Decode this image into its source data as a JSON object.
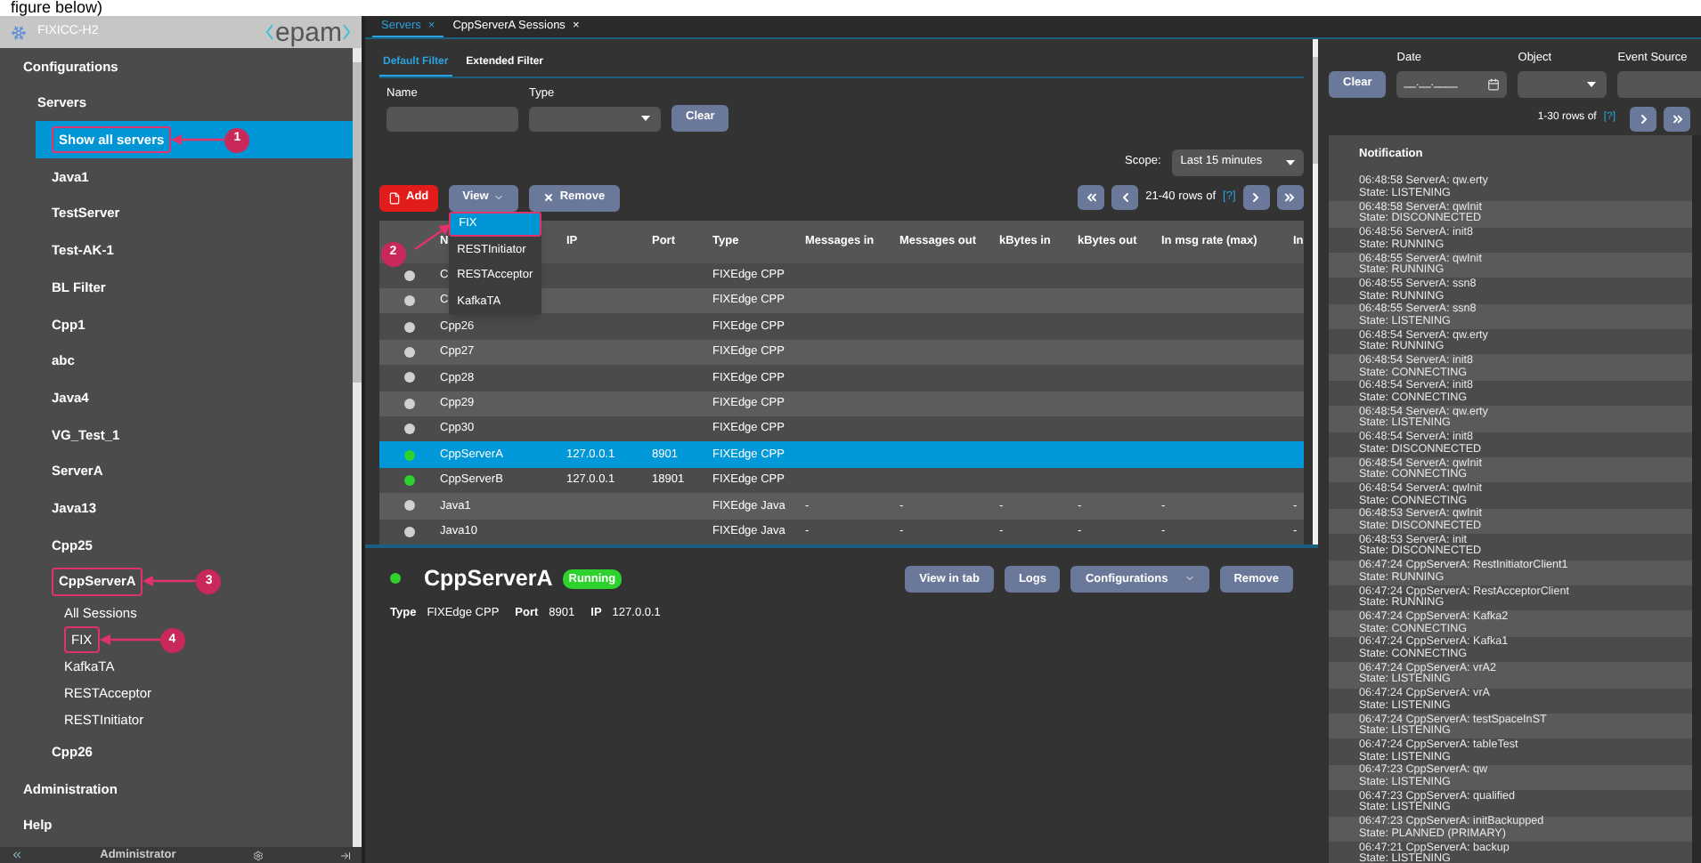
{
  "page_caption": "figure below)",
  "app": {
    "title": "FIXICC-H2",
    "logo": "epam"
  },
  "sidebar": {
    "items": [
      {
        "label": "Configurations",
        "selected": false,
        "children": [
          {
            "label": "Servers",
            "selected": false,
            "children": [
              {
                "label": "Show all servers",
                "selected": true,
                "callout": "1"
              },
              {
                "label": "Java1",
                "selected": false
              },
              {
                "label": "TestServer",
                "selected": false
              },
              {
                "label": "Test-AK-1",
                "selected": false
              },
              {
                "label": "BL Filter",
                "selected": false
              },
              {
                "label": "Cpp1",
                "selected": false
              },
              {
                "label": "abc",
                "selected": false
              },
              {
                "label": "Java4",
                "selected": false
              },
              {
                "label": "VG_Test_1",
                "selected": false
              },
              {
                "label": "ServerA",
                "selected": false
              },
              {
                "label": "Java13",
                "selected": false
              },
              {
                "label": "Cpp25",
                "selected": false
              },
              {
                "label": "CppServerA",
                "selected": false,
                "callout": "3",
                "children": [
                  {
                    "label": "All Sessions",
                    "selected": false
                  },
                  {
                    "label": "FIX",
                    "selected": false,
                    "callout": "4"
                  },
                  {
                    "label": "KafkaTA",
                    "selected": false
                  },
                  {
                    "label": "RESTAcceptor",
                    "selected": false
                  },
                  {
                    "label": "RESTInitiator",
                    "selected": false
                  }
                ]
              },
              {
                "label": "Cpp26",
                "selected": false
              }
            ]
          }
        ]
      },
      {
        "label": "Administration",
        "selected": false
      },
      {
        "label": "Help",
        "selected": false
      }
    ],
    "footer": {
      "user": "Administrator"
    }
  },
  "tabs": [
    {
      "label": "Servers",
      "selected": true,
      "close": "×"
    },
    {
      "label": "CppServerA Sessions",
      "selected": false,
      "close": "×"
    }
  ],
  "filter_tabs": [
    {
      "label": "Default Filter",
      "selected": true
    },
    {
      "label": "Extended Filter",
      "selected": false
    }
  ],
  "filter": {
    "name_label": "Name",
    "type_label": "Type",
    "clear": "Clear"
  },
  "scope": {
    "label": "Scope:",
    "value": "Last 15 minutes"
  },
  "toolbar": {
    "add": "Add",
    "view": "View",
    "remove": "Remove",
    "rows": "21-40 rows of",
    "help": "[?]"
  },
  "view_menu": [
    {
      "label": "FIX",
      "selected": true,
      "callout": "2"
    },
    {
      "label": "RESTInitiator",
      "selected": false
    },
    {
      "label": "RESTAcceptor",
      "selected": false
    },
    {
      "label": "KafkaTA",
      "selected": false
    }
  ],
  "table": {
    "columns": [
      "N",
      "IP",
      "Port",
      "Type",
      "Messages in",
      "Messages out",
      "kBytes in",
      "kBytes out",
      "In msg rate (max)",
      "In"
    ],
    "rows": [
      {
        "color": "#d0d0d0",
        "selected": false,
        "name": "C",
        "type": "FIXEdge CPP"
      },
      {
        "color": "#d0d0d0",
        "selected": false,
        "name": "C",
        "type": "FIXEdge CPP"
      },
      {
        "color": "#d0d0d0",
        "selected": false,
        "name": "Cpp26",
        "type": "FIXEdge CPP"
      },
      {
        "color": "#d0d0d0",
        "selected": false,
        "name": "Cpp27",
        "type": "FIXEdge CPP"
      },
      {
        "color": "#d0d0d0",
        "selected": false,
        "name": "Cpp28",
        "type": "FIXEdge CPP"
      },
      {
        "color": "#d0d0d0",
        "selected": false,
        "name": "Cpp29",
        "type": "FIXEdge CPP"
      },
      {
        "color": "#d0d0d0",
        "selected": false,
        "name": "Cpp30",
        "type": "FIXEdge CPP"
      },
      {
        "color": "#2fd12f",
        "selected": true,
        "name": "CppServerA",
        "ip": "127.0.0.1",
        "port": "8901",
        "type": "FIXEdge CPP"
      },
      {
        "color": "#2fd12f",
        "selected": false,
        "name": "CppServerB",
        "ip": "127.0.0.1",
        "port": "18901",
        "type": "FIXEdge CPP"
      },
      {
        "color": "#d0d0d0",
        "selected": false,
        "name": "Java1",
        "type": "FIXEdge Java",
        "metrics": [
          "-",
          "-",
          "-",
          "-",
          "-",
          "-"
        ]
      },
      {
        "color": "#d0d0d0",
        "selected": false,
        "name": "Java10",
        "type": "FIXEdge Java",
        "metrics": [
          "-",
          "-",
          "-",
          "-",
          "-",
          "-"
        ]
      }
    ]
  },
  "detail": {
    "color": "#2fd12f",
    "name": "CppServerA",
    "badge": "Running",
    "buttons": [
      {
        "label": "View in tab",
        "kind": "plain"
      },
      {
        "label": "Logs",
        "kind": "plain"
      },
      {
        "label": "Configurations",
        "kind": "menu"
      },
      {
        "label": "Remove",
        "kind": "plain"
      }
    ],
    "fields": [
      {
        "label": "Type",
        "value": "FIXEdge CPP"
      },
      {
        "label": "Port",
        "value": "8901"
      },
      {
        "label": "IP",
        "value": "127.0.0.1"
      }
    ]
  },
  "events": {
    "clear": "Clear",
    "date_label": "Date",
    "date_placeholder": "__.__.____",
    "object_label": "Object",
    "source_label": "Event Source",
    "rows": "1-30 rows of",
    "help": "[?]",
    "header": "Notification",
    "items": [
      {
        "title": "06:48:58 ServerA: qw.erty",
        "state": "State: LISTENING"
      },
      {
        "title": "06:48:58 ServerA: qwInit",
        "state": "State: DISCONNECTED"
      },
      {
        "title": "06:48:56 ServerA: init8",
        "state": "State: RUNNING"
      },
      {
        "title": "06:48:55 ServerA: qwInit",
        "state": "State: RUNNING"
      },
      {
        "title": "06:48:55 ServerA: ssn8",
        "state": "State: RUNNING"
      },
      {
        "title": "06:48:55 ServerA: ssn8",
        "state": "State: LISTENING"
      },
      {
        "title": "06:48:54 ServerA: qw.erty",
        "state": "State: RUNNING"
      },
      {
        "title": "06:48:54 ServerA: init8",
        "state": "State: CONNECTING"
      },
      {
        "title": "06:48:54 ServerA: init8",
        "state": "State: CONNECTING"
      },
      {
        "title": "06:48:54 ServerA: qw.erty",
        "state": "State: LISTENING"
      },
      {
        "title": "06:48:54 ServerA: init8",
        "state": "State: DISCONNECTED"
      },
      {
        "title": "06:48:54 ServerA: qwInit",
        "state": "State: CONNECTING"
      },
      {
        "title": "06:48:54 ServerA: qwInit",
        "state": "State: CONNECTING"
      },
      {
        "title": "06:48:53 ServerA: qwInit",
        "state": "State: DISCONNECTED"
      },
      {
        "title": "06:48:53 ServerA: init",
        "state": "State: DISCONNECTED"
      },
      {
        "title": "06:47:24 CppServerA: RestInitiatorClient1",
        "state": "State: RUNNING"
      },
      {
        "title": "06:47:24 CppServerA: RestAcceptorClient",
        "state": "State: RUNNING"
      },
      {
        "title": "06:47:24 CppServerA: Kafka2",
        "state": "State: CONNECTING"
      },
      {
        "title": "06:47:24 CppServerA: Kafka1",
        "state": "State: CONNECTING"
      },
      {
        "title": "06:47:24 CppServerA: vrA2",
        "state": "State: LISTENING"
      },
      {
        "title": "06:47:24 CppServerA: vrA",
        "state": "State: LISTENING"
      },
      {
        "title": "06:47:24 CppServerA: testSpaceInST",
        "state": "State: LISTENING"
      },
      {
        "title": "06:47:24 CppServerA: tableTest",
        "state": "State: LISTENING"
      },
      {
        "title": "06:47:23 CppServerA: qw",
        "state": "State: LISTENING"
      },
      {
        "title": "06:47:23 CppServerA: qualified",
        "state": "State: LISTENING"
      },
      {
        "title": "06:47:23 CppServerA: initBackupped",
        "state": "State: PLANNED (PRIMARY)"
      },
      {
        "title": "06:47:21 CppServerA: backup",
        "state": "State: LISTENING"
      }
    ]
  }
}
